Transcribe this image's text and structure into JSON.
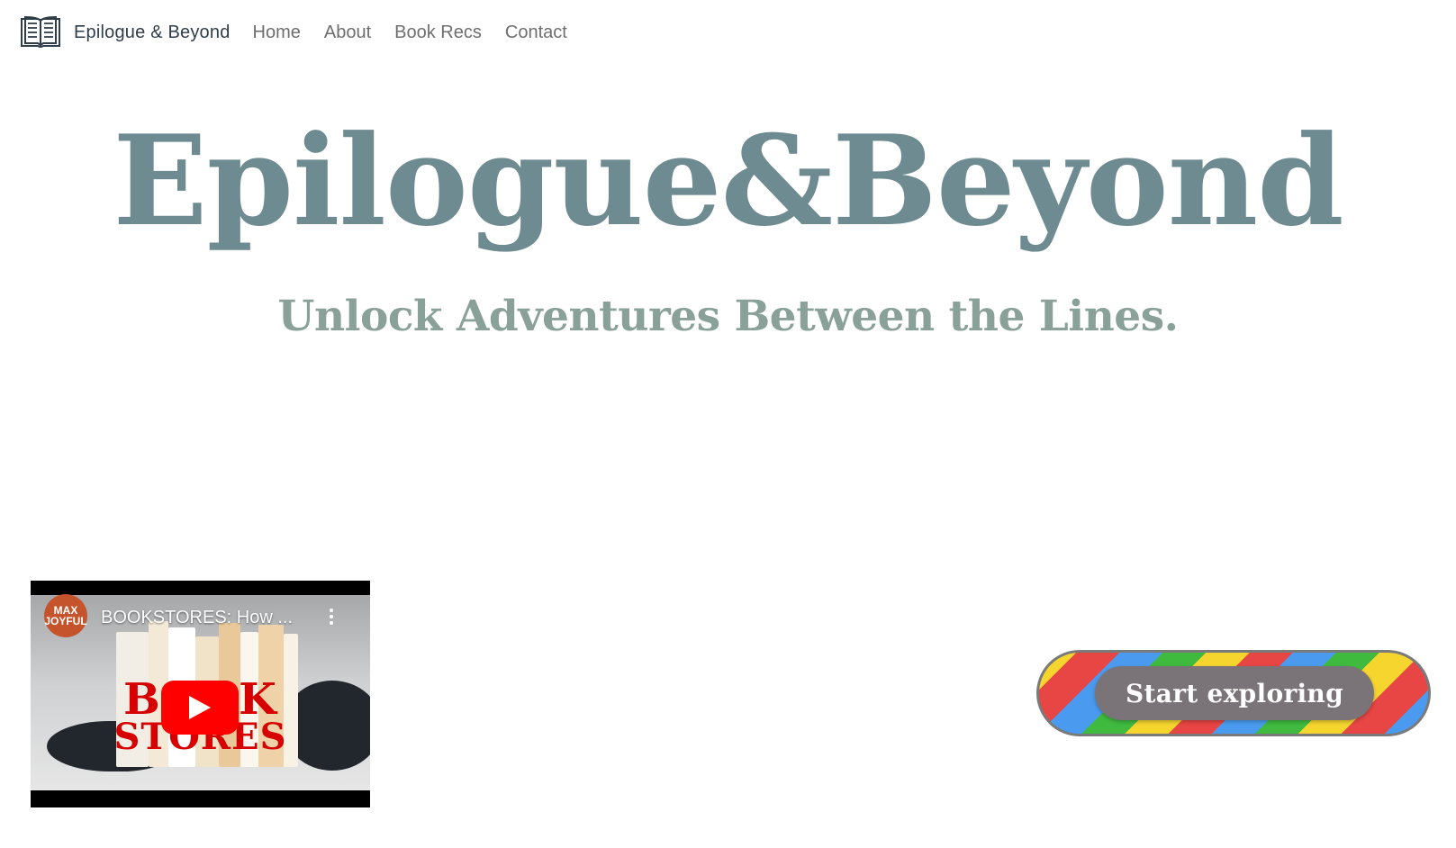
{
  "nav": {
    "brand": "Epilogue & Beyond",
    "brand_icon": "open-book-icon",
    "links": [
      "Home",
      "About",
      "Book Recs",
      "Contact"
    ]
  },
  "hero": {
    "title": "Epilogue&Beyond",
    "subtitle": "Unlock Adventures Between the Lines."
  },
  "video": {
    "title": "BOOKSTORES: How ...",
    "channel_avatar_text": "MAX JOYFUL",
    "thumbnail_text_line1": "BOOK",
    "thumbnail_text_line2": "STORES",
    "play_icon": "youtube-play-icon",
    "menu_icon": "more-vert-icon"
  },
  "cta": {
    "label": "Start exploring"
  },
  "colors": {
    "title": "#6e8b92",
    "subtitle": "#8aa19a",
    "nav_brand": "#2f3d49",
    "nav_link": "#6e6e6e",
    "cta_pill": "#7a7377"
  }
}
